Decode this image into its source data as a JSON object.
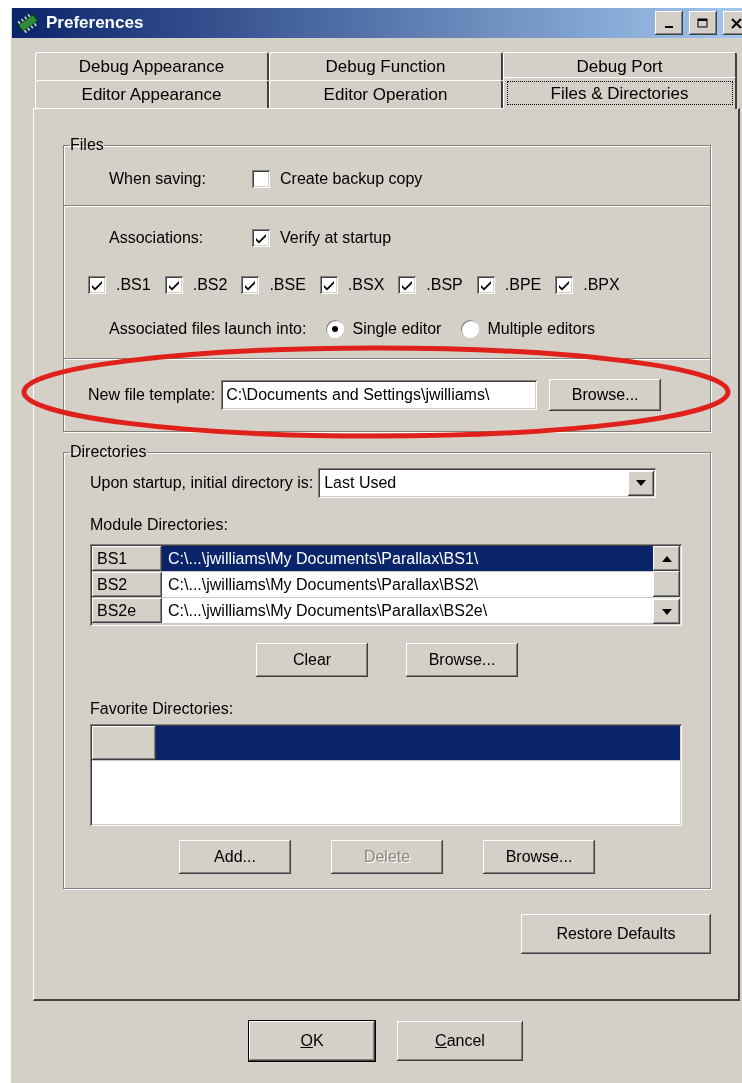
{
  "window": {
    "title": "Preferences"
  },
  "tab_rows": [
    {
      "tabs": [
        {
          "label": "Debug Appearance",
          "selected": false
        },
        {
          "label": "Debug Function",
          "selected": false
        },
        {
          "label": "Debug Port",
          "selected": false
        }
      ]
    },
    {
      "tabs": [
        {
          "label": "Editor Appearance",
          "selected": false
        },
        {
          "label": "Editor Operation",
          "selected": false
        },
        {
          "label": "Files & Directories",
          "selected": true
        }
      ]
    }
  ],
  "files": {
    "title": "Files",
    "when_saving": {
      "label": "When saving:",
      "checkbox": {
        "label": "Create backup copy",
        "checked": false
      }
    },
    "associations": {
      "label": "Associations:",
      "checkbox": {
        "label": "Verify at startup",
        "checked": true
      }
    },
    "extensions": [
      {
        "label": ".BS1",
        "checked": true
      },
      {
        "label": ".BS2",
        "checked": true
      },
      {
        "label": ".BSE",
        "checked": true
      },
      {
        "label": ".BSX",
        "checked": true
      },
      {
        "label": ".BSP",
        "checked": true
      },
      {
        "label": ".BPE",
        "checked": true
      },
      {
        "label": ".BPX",
        "checked": true
      }
    ],
    "launch": {
      "label": "Associated files launch into:",
      "options": [
        {
          "label": "Single editor",
          "selected": true
        },
        {
          "label": "Multiple editors",
          "selected": false
        }
      ]
    },
    "template": {
      "label": "New file template:",
      "value": "C:\\Documents and Settings\\jwilliams\\",
      "button": "Browse..."
    }
  },
  "highlight": {
    "kind": "ellipse"
  },
  "directories": {
    "title": "Directories",
    "startup": {
      "label": "Upon startup, initial directory is:",
      "value": "Last Used"
    },
    "module": {
      "label": "Module Directories:",
      "rows": [
        {
          "name": "BS1",
          "path": "C:\\...\\jwilliams\\My Documents\\Parallax\\BS1\\",
          "selected": true
        },
        {
          "name": "BS2",
          "path": "C:\\...\\jwilliams\\My Documents\\Parallax\\BS2\\",
          "selected": false
        },
        {
          "name": "BS2e",
          "path": "C:\\...\\jwilliams\\My Documents\\Parallax\\BS2e\\",
          "selected": false
        }
      ],
      "buttons": [
        {
          "label": "Clear",
          "disabled": false
        },
        {
          "label": "Browse...",
          "disabled": false
        }
      ]
    },
    "favorite": {
      "label": "Favorite Directories:",
      "rows": [
        {
          "selected": true
        }
      ],
      "buttons": [
        {
          "label": "Add...",
          "disabled": false
        },
        {
          "label": "Delete",
          "disabled": true
        },
        {
          "label": "Browse...",
          "disabled": false
        }
      ]
    }
  },
  "restore_button": {
    "label": "Restore Defaults"
  },
  "dialog_buttons": [
    {
      "label": "OK",
      "default": true,
      "mnemonic_first": true
    },
    {
      "label": "Cancel",
      "default": false,
      "mnemonic_first": true
    }
  ]
}
